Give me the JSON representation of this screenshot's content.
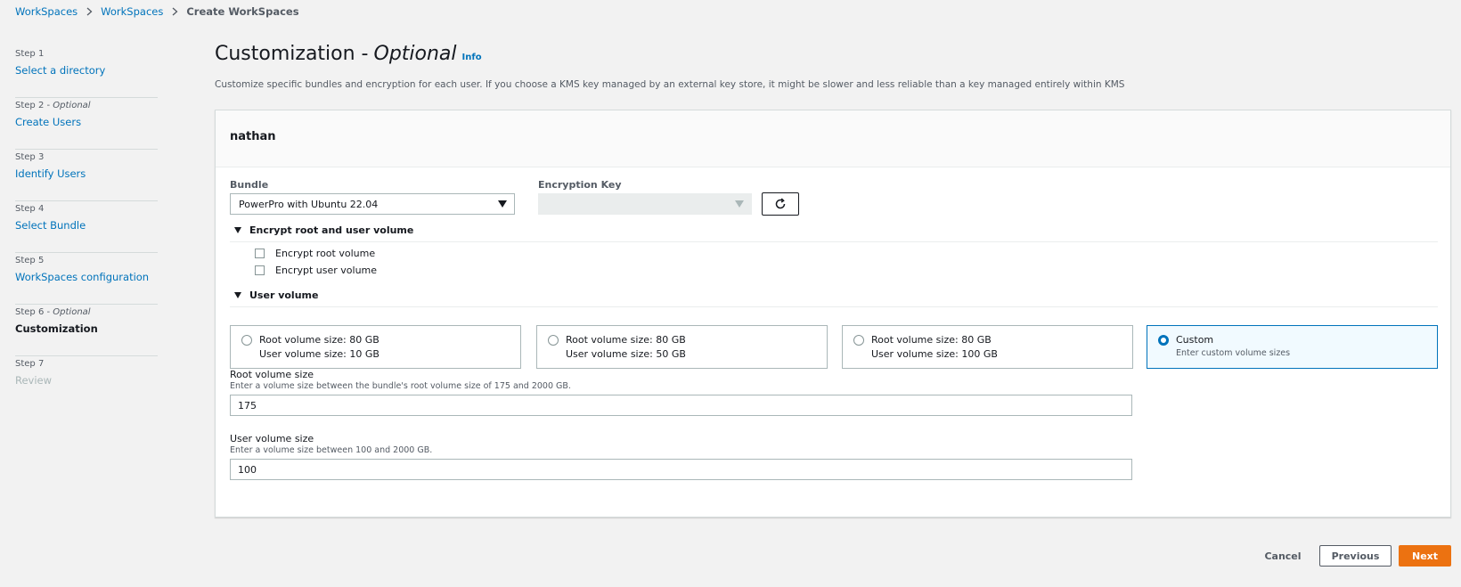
{
  "breadcrumb": {
    "items": [
      "WorkSpaces",
      "WorkSpaces"
    ],
    "current": "Create WorkSpaces"
  },
  "steps": [
    {
      "num": "Step 1",
      "optional": "",
      "label": "Select a directory"
    },
    {
      "num": "Step 2 - ",
      "optional": "Optional",
      "label": "Create Users"
    },
    {
      "num": "Step 3",
      "optional": "",
      "label": "Identify Users"
    },
    {
      "num": "Step 4",
      "optional": "",
      "label": "Select Bundle"
    },
    {
      "num": "Step 5",
      "optional": "",
      "label": "WorkSpaces configuration"
    },
    {
      "num": "Step 6 - ",
      "optional": "Optional",
      "label": "Customization"
    },
    {
      "num": "Step 7",
      "optional": "",
      "label": "Review"
    }
  ],
  "page": {
    "title": "Customization -",
    "title_optional": "Optional",
    "info": "Info",
    "description": "Customize specific bundles and encryption for each user. If you choose a KMS key managed by an external key store, it might be slower and less reliable than a key managed entirely within KMS"
  },
  "panel": {
    "user": "nathan",
    "bundle_label": "Bundle",
    "bundle_value": "PowerPro with Ubuntu 22.04",
    "encryption_label": "Encryption Key",
    "encryption_value": "",
    "encrypt_section": "Encrypt root and user volume",
    "encrypt_root": "Encrypt root volume",
    "encrypt_user": "Encrypt user volume",
    "user_volume_section": "User volume",
    "volume_options": [
      {
        "line1": "Root volume size: 80 GB",
        "line2": "User volume size: 10 GB"
      },
      {
        "line1": "Root volume size: 80 GB",
        "line2": "User volume size: 50 GB"
      },
      {
        "line1": "Root volume size: 80 GB",
        "line2": "User volume size: 100 GB"
      },
      {
        "line1": "Custom",
        "line2": "Enter custom volume sizes"
      }
    ],
    "root_size_label": "Root volume size",
    "root_size_hint": "Enter a volume size between the bundle's root volume size of 175 and 2000 GB.",
    "root_size_value": "175",
    "user_size_label": "User volume size",
    "user_size_hint": "Enter a volume size between 100 and 2000 GB.",
    "user_size_value": "100"
  },
  "footer": {
    "cancel": "Cancel",
    "previous": "Previous",
    "next": "Next"
  },
  "colors": {
    "link": "#0073bb",
    "primary_button": "#ec7211",
    "selected_card_border": "#0073bb"
  }
}
